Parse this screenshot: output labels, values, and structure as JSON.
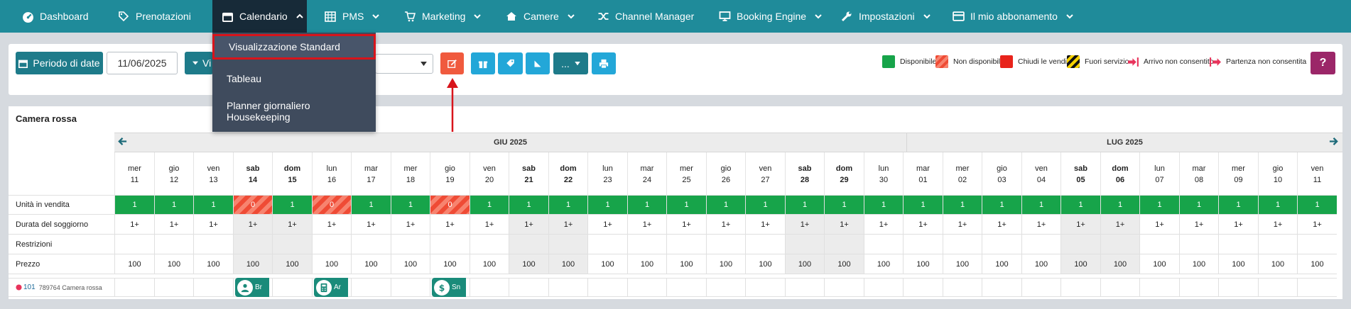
{
  "nav": {
    "items": [
      {
        "label": "Dashboard",
        "icon": "dashboard-icon"
      },
      {
        "label": "Prenotazioni",
        "icon": "tag-icon"
      },
      {
        "label": "Calendario",
        "icon": "calendar-icon"
      },
      {
        "label": "PMS",
        "icon": "grid-icon"
      },
      {
        "label": "Marketing",
        "icon": "cart-icon"
      },
      {
        "label": "Camere",
        "icon": "home-icon"
      },
      {
        "label": "Channel Manager",
        "icon": "shuffle-icon"
      },
      {
        "label": "Booking Engine",
        "icon": "monitor-icon"
      },
      {
        "label": "Impostazioni",
        "icon": "wrench-icon"
      },
      {
        "label": "Il mio abbonamento",
        "icon": "card-icon"
      }
    ],
    "active": "Calendario"
  },
  "dropdown": {
    "items": [
      "Visualizzazione Standard",
      "Tableau",
      "Planner giornaliero Housekeeping"
    ],
    "selected": "Visualizzazione Standard"
  },
  "toolbar": {
    "period_label": "Periodo di date",
    "date_value": "11/06/2025",
    "view_label_partial": "Vi",
    "help_label": "?",
    "more_label": "..."
  },
  "legend": [
    {
      "label": "Disponibile",
      "color": "#17a44a"
    },
    {
      "label": "Non disponibile",
      "color": "#ef4b35"
    },
    {
      "label": "Chiudi le vendite",
      "color": "#e8231b"
    },
    {
      "label": "Fuori servizio",
      "color": "#f5d100"
    },
    {
      "label": "Arrivo non consentito",
      "color": "#e8335b"
    },
    {
      "label": "Partenza non consentita",
      "color": "#e8335b"
    }
  ],
  "calendar": {
    "room_title": "Camera rossa",
    "months": [
      "GIU 2025",
      "LUG 2025"
    ],
    "days": [
      {
        "dow": "mer",
        "d": "11",
        "we": false
      },
      {
        "dow": "gio",
        "d": "12",
        "we": false
      },
      {
        "dow": "ven",
        "d": "13",
        "we": false
      },
      {
        "dow": "sab",
        "d": "14",
        "we": true
      },
      {
        "dow": "dom",
        "d": "15",
        "we": true
      },
      {
        "dow": "lun",
        "d": "16",
        "we": false
      },
      {
        "dow": "mar",
        "d": "17",
        "we": false
      },
      {
        "dow": "mer",
        "d": "18",
        "we": false
      },
      {
        "dow": "gio",
        "d": "19",
        "we": false
      },
      {
        "dow": "ven",
        "d": "20",
        "we": false
      },
      {
        "dow": "sab",
        "d": "21",
        "we": true
      },
      {
        "dow": "dom",
        "d": "22",
        "we": true
      },
      {
        "dow": "lun",
        "d": "23",
        "we": false
      },
      {
        "dow": "mar",
        "d": "24",
        "we": false
      },
      {
        "dow": "mer",
        "d": "25",
        "we": false
      },
      {
        "dow": "gio",
        "d": "26",
        "we": false
      },
      {
        "dow": "ven",
        "d": "27",
        "we": false
      },
      {
        "dow": "sab",
        "d": "28",
        "we": true
      },
      {
        "dow": "dom",
        "d": "29",
        "we": true
      },
      {
        "dow": "lun",
        "d": "30",
        "we": false
      },
      {
        "dow": "mar",
        "d": "01",
        "we": false
      },
      {
        "dow": "mer",
        "d": "02",
        "we": false
      },
      {
        "dow": "gio",
        "d": "03",
        "we": false
      },
      {
        "dow": "ven",
        "d": "04",
        "we": false
      },
      {
        "dow": "sab",
        "d": "05",
        "we": true
      },
      {
        "dow": "dom",
        "d": "06",
        "we": true
      },
      {
        "dow": "lun",
        "d": "07",
        "we": false
      },
      {
        "dow": "mar",
        "d": "08",
        "we": false
      },
      {
        "dow": "mer",
        "d": "09",
        "we": false
      },
      {
        "dow": "gio",
        "d": "10",
        "we": false
      },
      {
        "dow": "ven",
        "d": "11",
        "we": false
      }
    ],
    "row_labels": [
      "Unità in vendita",
      "Durata del soggiorno",
      "Restrizioni",
      "Prezzo"
    ],
    "units": [
      "1",
      "1",
      "1",
      "0",
      "1",
      "0",
      "1",
      "1",
      "0",
      "1",
      "1",
      "1",
      "1",
      "1",
      "1",
      "1",
      "1",
      "1",
      "1",
      "1",
      "1",
      "1",
      "1",
      "1",
      "1",
      "1",
      "1",
      "1",
      "1",
      "1",
      "1"
    ],
    "stay": "1+",
    "price": "100",
    "room_unit": {
      "number": "101",
      "code": "789764 Camera rossa"
    },
    "bookings": [
      {
        "label": "Br",
        "icon": "person-icon",
        "day_index": 3
      },
      {
        "label": "Ar",
        "icon": "calculator-icon",
        "day_index": 5
      },
      {
        "label": "Sn",
        "icon": "dollar-icon",
        "day_index": 8
      }
    ]
  }
}
